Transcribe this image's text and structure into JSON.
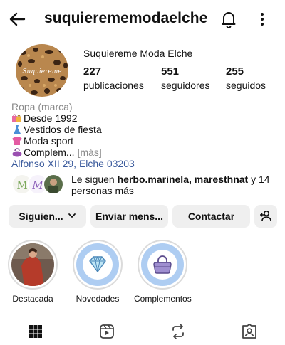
{
  "header": {
    "username": "suquierememodaelche",
    "icons": {
      "back": "arrow-left-icon",
      "notifications": "bell-icon",
      "menu": "more-vertical-icon"
    }
  },
  "profile": {
    "display_name": "Suquiereme Moda Elche",
    "avatar_text": "Suquiereme",
    "stats": {
      "posts": {
        "value": "227",
        "label": "publicaciones"
      },
      "followers": {
        "value": "551",
        "label": "seguidores"
      },
      "following": {
        "value": "255",
        "label": "seguidos"
      }
    }
  },
  "bio": {
    "category": "Ropa (marca)",
    "lines": [
      {
        "emoji": "shopping-bags-emoji",
        "text": "Desde 1992"
      },
      {
        "emoji": "dress-emoji",
        "text": "Vestidos de fiesta"
      },
      {
        "emoji": "tshirt-emoji",
        "text": "Moda sport"
      },
      {
        "emoji": "purse-emoji",
        "text": "Complem...",
        "more": "[más]"
      }
    ],
    "address": "Alfonso XII 29, Elche 03203"
  },
  "followed_by": {
    "prefix": "Le siguen ",
    "names": "herbo.marinela, maresthnat",
    "suffix": " y 14 personas más"
  },
  "actions": {
    "following": "Siguien...",
    "message": "Enviar mens...",
    "contact": "Contactar"
  },
  "highlights": [
    {
      "label": "Destacada",
      "icon": "photo-thumbnail"
    },
    {
      "label": "Novedades",
      "icon": "diamond-icon"
    },
    {
      "label": "Complementos",
      "icon": "handbag-icon"
    }
  ],
  "tabs": [
    {
      "name": "grid-icon"
    },
    {
      "name": "reels-icon"
    },
    {
      "name": "repost-icon"
    },
    {
      "name": "tagged-icon"
    }
  ],
  "colors": {
    "link": "#3a5a9c",
    "button_bg": "#efefef",
    "muted": "#8a8a8a"
  }
}
